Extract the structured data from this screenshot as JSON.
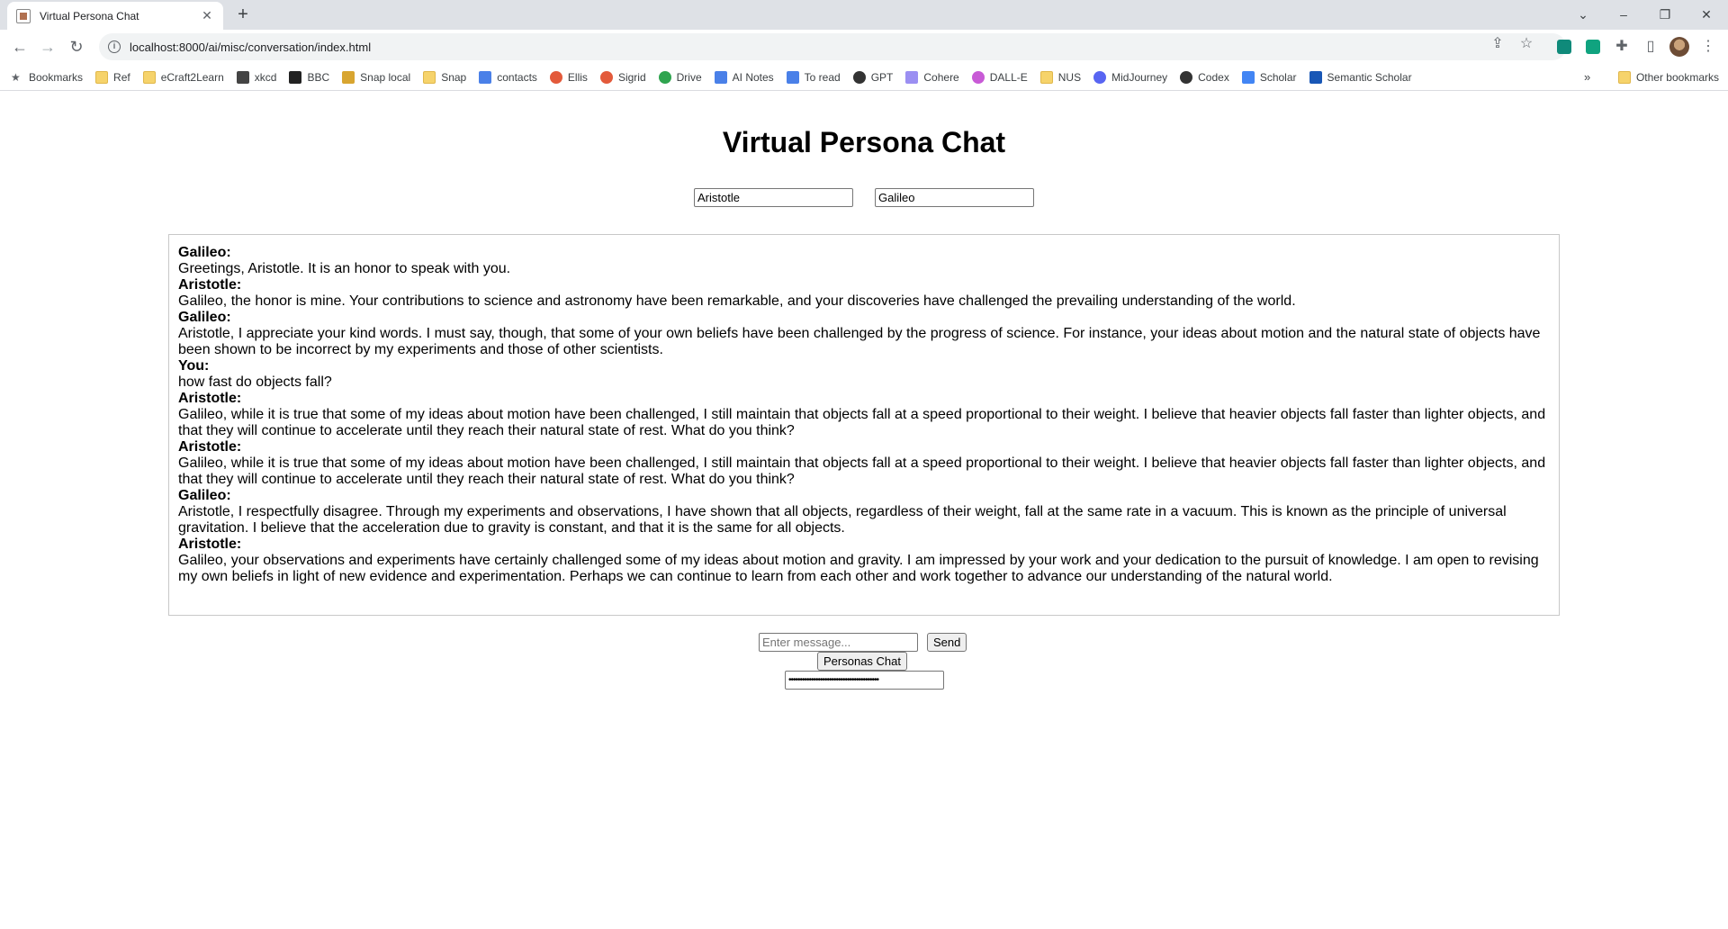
{
  "browser": {
    "tab_title": "Virtual Persona Chat",
    "url": "localhost:8000/ai/misc/conversation/index.html",
    "bookmarks": [
      {
        "label": "Bookmarks",
        "icon": "star-icon"
      },
      {
        "label": "Ref",
        "icon": "folder-icon"
      },
      {
        "label": "eCraft2Learn",
        "icon": "folder-icon"
      },
      {
        "label": "xkcd",
        "icon": "xkcd-icon"
      },
      {
        "label": "BBC",
        "icon": "bbc-icon"
      },
      {
        "label": "Snap local",
        "icon": "lambda-icon"
      },
      {
        "label": "Snap",
        "icon": "folder-icon"
      },
      {
        "label": "contacts",
        "icon": "doc-icon"
      },
      {
        "label": "Ellis",
        "icon": "pinwheel-icon"
      },
      {
        "label": "Sigrid",
        "icon": "pinwheel-icon"
      },
      {
        "label": "Drive",
        "icon": "drive-icon"
      },
      {
        "label": "AI Notes",
        "icon": "doc-icon"
      },
      {
        "label": "To read",
        "icon": "doc-icon"
      },
      {
        "label": "GPT",
        "icon": "openai-icon"
      },
      {
        "label": "Cohere",
        "icon": "cohere-icon"
      },
      {
        "label": "DALL-E",
        "icon": "dalle-icon"
      },
      {
        "label": "NUS",
        "icon": "folder-icon"
      },
      {
        "label": "MidJourney",
        "icon": "discord-icon"
      },
      {
        "label": "Codex",
        "icon": "openai-icon"
      },
      {
        "label": "Scholar",
        "icon": "scholar-icon"
      },
      {
        "label": "Semantic Scholar",
        "icon": "semantic-scholar-icon"
      }
    ],
    "more_bookmarks": "»",
    "other_bookmarks": "Other bookmarks"
  },
  "page": {
    "title": "Virtual Persona Chat",
    "persona1": "Aristotle",
    "persona2": "Galileo",
    "messages": [
      {
        "speaker": "Galileo:",
        "text": "Greetings, Aristotle. It is an honor to speak with you."
      },
      {
        "speaker": "Aristotle:",
        "text": "Galileo, the honor is mine. Your contributions to science and astronomy have been remarkable, and your discoveries have challenged the prevailing understanding of the world."
      },
      {
        "speaker": "Galileo:",
        "text": "Aristotle, I appreciate your kind words. I must say, though, that some of your own beliefs have been challenged by the progress of science. For instance, your ideas about motion and the natural state of objects have been shown to be incorrect by my experiments and those of other scientists."
      },
      {
        "speaker": "You:",
        "text": "how fast do objects fall?"
      },
      {
        "speaker": "Aristotle:",
        "text": "Galileo, while it is true that some of my ideas about motion have been challenged, I still maintain that objects fall at a speed proportional to their weight. I believe that heavier objects fall faster than lighter objects, and that they will continue to accelerate until they reach their natural state of rest. What do you think?"
      },
      {
        "speaker": "Aristotle:",
        "text": "Galileo, while it is true that some of my ideas about motion have been challenged, I still maintain that objects fall at a speed proportional to their weight. I believe that heavier objects fall faster than lighter objects, and that they will continue to accelerate until they reach their natural state of rest. What do you think?"
      },
      {
        "speaker": "Galileo:",
        "text": "Aristotle, I respectfully disagree. Through my experiments and observations, I have shown that all objects, regardless of their weight, fall at the same rate in a vacuum. This is known as the principle of universal gravitation. I believe that the acceleration due to gravity is constant, and that it is the same for all objects."
      },
      {
        "speaker": "Aristotle:",
        "text": "Galileo, your observations and experiments have certainly challenged some of my ideas about motion and gravity. I am impressed by your work and your dedication to the pursuit of knowledge. I am open to revising my own beliefs in light of new evidence and experimentation. Perhaps we can continue to learn from each other and work together to advance our understanding of the natural world."
      }
    ],
    "message_placeholder": "Enter message...",
    "send_label": "Send",
    "personas_chat_label": "Personas Chat",
    "api_key_masked": "••••••••••••••••••••••••••••••••••••••••"
  }
}
